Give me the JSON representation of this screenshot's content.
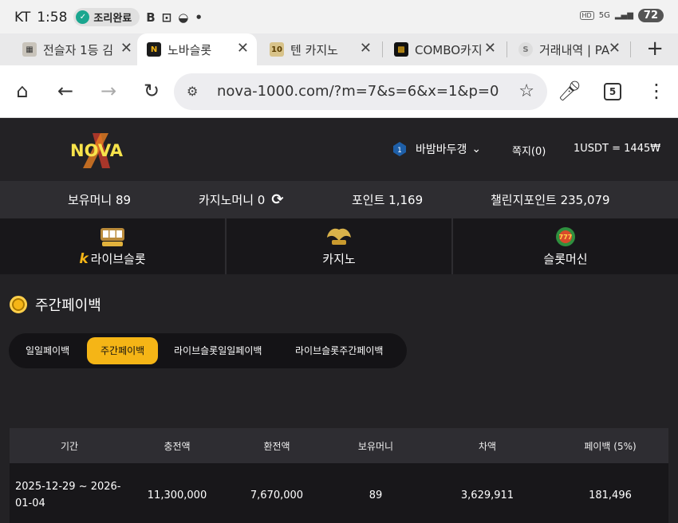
{
  "status_bar": {
    "carrier": "KT",
    "time": "1:58",
    "pill_text": "조리완료",
    "battery": "72"
  },
  "tabs": [
    {
      "title": "전슬자 1등 김",
      "favicon": "slot-favicon"
    },
    {
      "title": "노바슬롯",
      "favicon": "N",
      "active": true
    },
    {
      "title": "텐 카지노",
      "favicon": "ten-favicon"
    },
    {
      "title": "COMBO카지",
      "favicon": "combo-favicon"
    },
    {
      "title": "거래내역 | PA",
      "favicon": "S"
    }
  ],
  "toolbar": {
    "url": "nova-1000.com/?m=7&s=6&x=1&p=0",
    "tab_count": "5"
  },
  "header": {
    "logo_text": "NOVA",
    "username": "바밤바두갱",
    "messages": "쪽지(0)",
    "rate": "1USDT = 1445₩"
  },
  "balances": {
    "money": "보유머니 89",
    "casino_money": "카지노머니 0",
    "points": "포인트 1,169",
    "challenge_points": "챌린지포인트 235,079"
  },
  "game_nav": [
    {
      "label": "라이브슬롯"
    },
    {
      "label": "카지노"
    },
    {
      "label": "슬롯머신"
    }
  ],
  "page": {
    "title": "주간페이백"
  },
  "subtabs": [
    {
      "label": "일일페이백"
    },
    {
      "label": "주간페이백",
      "active": true
    },
    {
      "label": "라이브슬롯일일페이백"
    },
    {
      "label": "라이브슬롯주간페이백"
    }
  ],
  "table": {
    "columns": [
      "기간",
      "충전액",
      "환전액",
      "보유머니",
      "차액",
      "페이백 (5%)"
    ],
    "rows": [
      {
        "period": "2025-12-29 ~ 2026-01-04",
        "deposit": "11,300,000",
        "withdraw": "7,670,000",
        "money": "89",
        "diff": "3,629,911",
        "payback": "181,496"
      }
    ]
  },
  "colors": {
    "accent": "#f5b516",
    "background": "#232225",
    "panel": "#2e2d31"
  }
}
